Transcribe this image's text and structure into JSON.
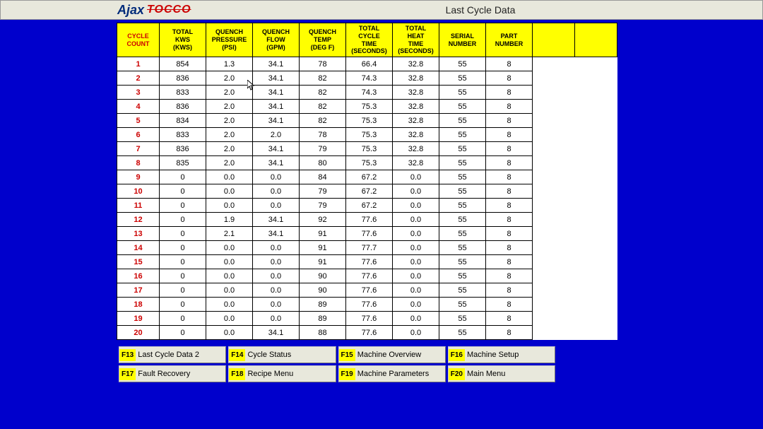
{
  "header": {
    "logo_ajax": "Ajax",
    "logo_tocco": "TOCCO",
    "title": "Last Cycle Data"
  },
  "columns": [
    "CYCLE\nCOUNT",
    "TOTAL\nKWS\n(KWS)",
    "QUENCH\nPRESSURE\n(PSI)",
    "QUENCH\nFLOW\n(GPM)",
    "QUENCH\nTEMP\n(DEG F)",
    "TOTAL\nCYCLE\nTIME\n(SECONDS)",
    "TOTAL\nHEAT\nTIME\n(SECONDS)",
    "SERIAL\nNUMBER",
    "PART\nNUMBER"
  ],
  "rows": [
    {
      "cycle": "1",
      "kws": "854",
      "qp": "1.3",
      "qf": "34.1",
      "qt": "78",
      "tct": "66.4",
      "tht": "32.8",
      "sn": "55",
      "pn": "8"
    },
    {
      "cycle": "2",
      "kws": "836",
      "qp": "2.0",
      "qf": "34.1",
      "qt": "82",
      "tct": "74.3",
      "tht": "32.8",
      "sn": "55",
      "pn": "8"
    },
    {
      "cycle": "3",
      "kws": "833",
      "qp": "2.0",
      "qf": "34.1",
      "qt": "82",
      "tct": "74.3",
      "tht": "32.8",
      "sn": "55",
      "pn": "8"
    },
    {
      "cycle": "4",
      "kws": "836",
      "qp": "2.0",
      "qf": "34.1",
      "qt": "82",
      "tct": "75.3",
      "tht": "32.8",
      "sn": "55",
      "pn": "8"
    },
    {
      "cycle": "5",
      "kws": "834",
      "qp": "2.0",
      "qf": "34.1",
      "qt": "82",
      "tct": "75.3",
      "tht": "32.8",
      "sn": "55",
      "pn": "8"
    },
    {
      "cycle": "6",
      "kws": "833",
      "qp": "2.0",
      "qf": "2.0",
      "qt": "78",
      "tct": "75.3",
      "tht": "32.8",
      "sn": "55",
      "pn": "8"
    },
    {
      "cycle": "7",
      "kws": "836",
      "qp": "2.0",
      "qf": "34.1",
      "qt": "79",
      "tct": "75.3",
      "tht": "32.8",
      "sn": "55",
      "pn": "8"
    },
    {
      "cycle": "8",
      "kws": "835",
      "qp": "2.0",
      "qf": "34.1",
      "qt": "80",
      "tct": "75.3",
      "tht": "32.8",
      "sn": "55",
      "pn": "8"
    },
    {
      "cycle": "9",
      "kws": "0",
      "qp": "0.0",
      "qf": "0.0",
      "qt": "84",
      "tct": "67.2",
      "tht": "0.0",
      "sn": "55",
      "pn": "8"
    },
    {
      "cycle": "10",
      "kws": "0",
      "qp": "0.0",
      "qf": "0.0",
      "qt": "79",
      "tct": "67.2",
      "tht": "0.0",
      "sn": "55",
      "pn": "8"
    },
    {
      "cycle": "11",
      "kws": "0",
      "qp": "0.0",
      "qf": "0.0",
      "qt": "79",
      "tct": "67.2",
      "tht": "0.0",
      "sn": "55",
      "pn": "8"
    },
    {
      "cycle": "12",
      "kws": "0",
      "qp": "1.9",
      "qf": "34.1",
      "qt": "92",
      "tct": "77.6",
      "tht": "0.0",
      "sn": "55",
      "pn": "8"
    },
    {
      "cycle": "13",
      "kws": "0",
      "qp": "2.1",
      "qf": "34.1",
      "qt": "91",
      "tct": "77.6",
      "tht": "0.0",
      "sn": "55",
      "pn": "8"
    },
    {
      "cycle": "14",
      "kws": "0",
      "qp": "0.0",
      "qf": "0.0",
      "qt": "91",
      "tct": "77.7",
      "tht": "0.0",
      "sn": "55",
      "pn": "8"
    },
    {
      "cycle": "15",
      "kws": "0",
      "qp": "0.0",
      "qf": "0.0",
      "qt": "91",
      "tct": "77.6",
      "tht": "0.0",
      "sn": "55",
      "pn": "8"
    },
    {
      "cycle": "16",
      "kws": "0",
      "qp": "0.0",
      "qf": "0.0",
      "qt": "90",
      "tct": "77.6",
      "tht": "0.0",
      "sn": "55",
      "pn": "8"
    },
    {
      "cycle": "17",
      "kws": "0",
      "qp": "0.0",
      "qf": "0.0",
      "qt": "90",
      "tct": "77.6",
      "tht": "0.0",
      "sn": "55",
      "pn": "8"
    },
    {
      "cycle": "18",
      "kws": "0",
      "qp": "0.0",
      "qf": "0.0",
      "qt": "89",
      "tct": "77.6",
      "tht": "0.0",
      "sn": "55",
      "pn": "8"
    },
    {
      "cycle": "19",
      "kws": "0",
      "qp": "0.0",
      "qf": "0.0",
      "qt": "89",
      "tct": "77.6",
      "tht": "0.0",
      "sn": "55",
      "pn": "8"
    },
    {
      "cycle": "20",
      "kws": "0",
      "qp": "0.0",
      "qf": "34.1",
      "qt": "88",
      "tct": "77.6",
      "tht": "0.0",
      "sn": "55",
      "pn": "8"
    }
  ],
  "nav": [
    {
      "key": "F13",
      "label": "Last Cycle Data 2"
    },
    {
      "key": "F14",
      "label": "Cycle Status"
    },
    {
      "key": "F15",
      "label": "Machine Overview"
    },
    {
      "key": "F16",
      "label": "Machine Setup"
    },
    {
      "key": "F17",
      "label": "Fault Recovery"
    },
    {
      "key": "F18",
      "label": "Recipe Menu"
    },
    {
      "key": "F19",
      "label": "Machine Parameters"
    },
    {
      "key": "F20",
      "label": "Main Menu"
    }
  ]
}
